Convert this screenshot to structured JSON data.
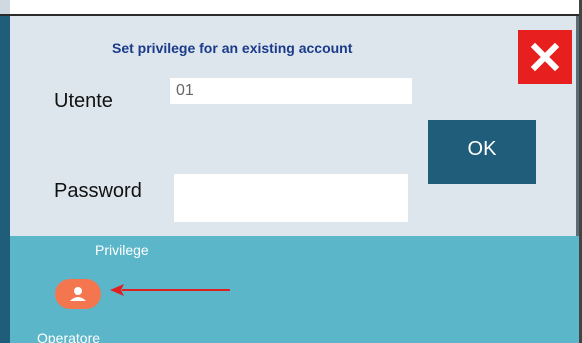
{
  "dialog": {
    "title": "Set privilege for an existing account",
    "user_label": "Utente",
    "user_value": "01",
    "password_label": "Password",
    "password_value": "",
    "ok_label": "OK"
  },
  "privilege": {
    "heading": "Privilege",
    "role_label": "Operatore"
  },
  "icons": {
    "close": "close-icon",
    "avatar": "user-icon",
    "arrow": "arrow-left-icon"
  },
  "colors": {
    "dialog_bg": "#dde6ec",
    "title_text": "#1a3a8a",
    "close_bg": "#e81f1f",
    "ok_bg": "#1f5d7a",
    "panel_bg": "#5bb6c9",
    "avatar_bg": "#f4764e",
    "arrow": "#e02020"
  }
}
